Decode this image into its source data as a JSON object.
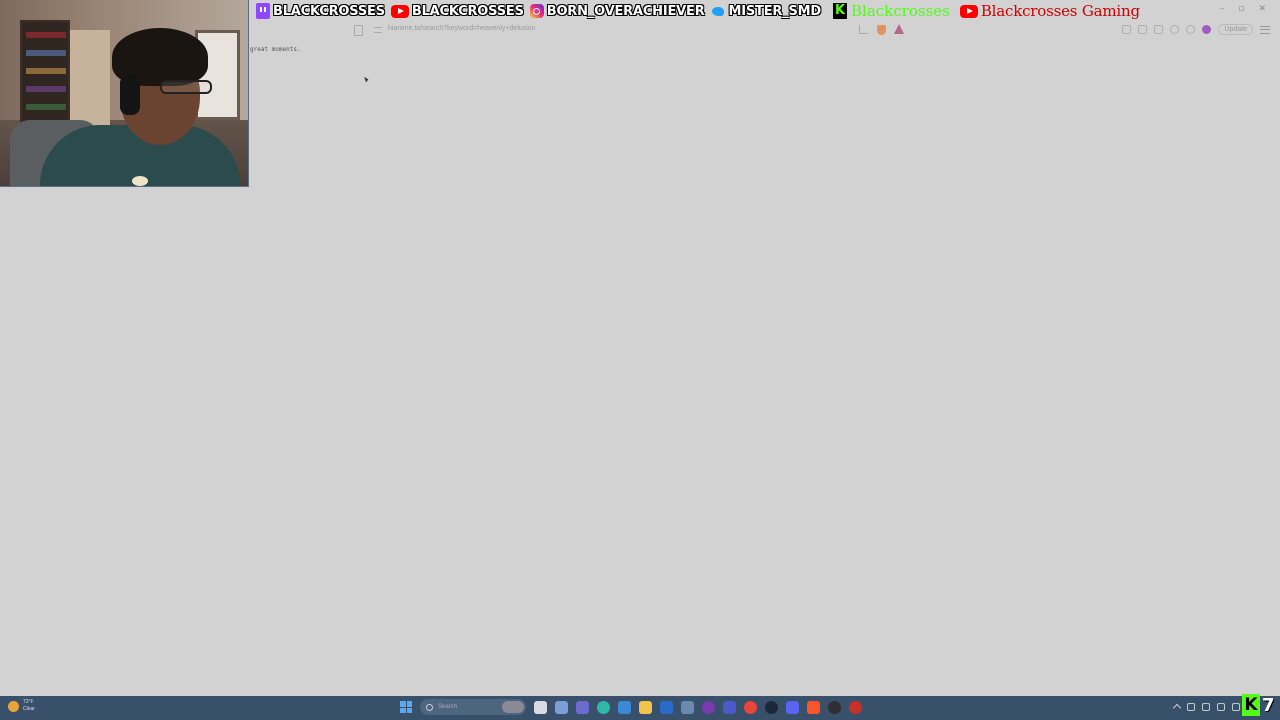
{
  "overlay": {
    "socials": [
      {
        "platform_icon": "twitch-icon",
        "handle": "BLACKCROSSES"
      },
      {
        "platform_icon": "youtube-icon",
        "handle": "BLACKCROSSES"
      },
      {
        "platform_icon": "instagram-icon",
        "handle": "BORN_OVERACHIEVER"
      },
      {
        "platform_icon": "twitter-icon",
        "handle": "MISTER_SMD"
      }
    ],
    "kick": {
      "logo_letter": "K",
      "handle": "Blackcrosses"
    },
    "youtube_gaming": {
      "label": "Blackcrosses Gaming"
    },
    "colors": {
      "twitch": "#9146ff",
      "youtube": "#ff0000",
      "kick": "#53fc18",
      "twitter": "#1da1f2"
    }
  },
  "browser": {
    "url": "hianime.to/search?keyword=heavenly+delusion",
    "update_label": "Update",
    "window_controls": [
      "–",
      "▫",
      "✕"
    ]
  },
  "page": {
    "body_text": "great moments."
  },
  "taskbar": {
    "weather": {
      "temp": "72°F",
      "condition": "Clear"
    },
    "search_placeholder": "Search",
    "kick_badge": {
      "letter": "K",
      "count": "7"
    }
  }
}
